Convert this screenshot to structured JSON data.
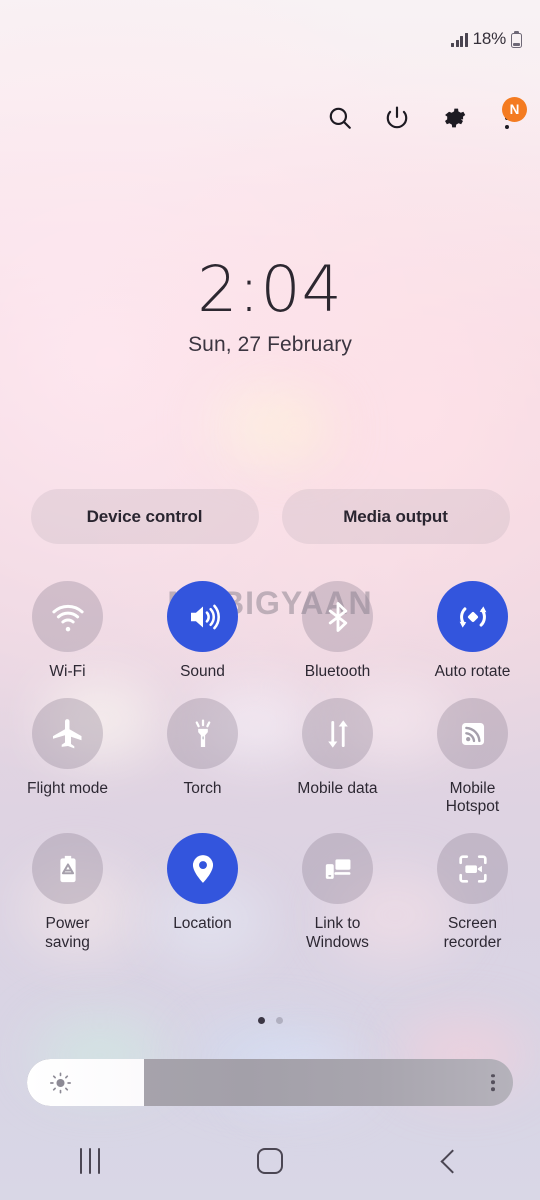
{
  "status_bar": {
    "battery_percent": "18%",
    "signal_icon": "signal-bars-icon",
    "battery_icon": "battery-low-icon"
  },
  "action_bar": {
    "search_icon": "search-icon",
    "power_icon": "power-icon",
    "settings_icon": "gear-icon",
    "more_icon": "kebab-menu-icon",
    "badge_label": "N",
    "badge_color": "#f47b20"
  },
  "clock": {
    "time": "2:04",
    "date": "Sun, 27 February"
  },
  "shortcuts": {
    "device_control": "Device control",
    "media_output": "Media output"
  },
  "toggles": [
    {
      "label": "Wi-Fi",
      "icon": "wifi-icon",
      "active": false
    },
    {
      "label": "Sound",
      "icon": "volume-speaker-icon",
      "active": true
    },
    {
      "label": "Bluetooth",
      "icon": "bluetooth-icon",
      "active": false
    },
    {
      "label": "Auto rotate",
      "icon": "auto-rotate-icon",
      "active": true
    },
    {
      "label": "Flight mode",
      "icon": "airplane-icon",
      "active": false
    },
    {
      "label": "Torch",
      "icon": "flashlight-icon",
      "active": false
    },
    {
      "label": "Mobile data",
      "icon": "data-arrows-icon",
      "active": false
    },
    {
      "label": "Mobile Hotspot",
      "icon": "hotspot-icon",
      "active": false
    },
    {
      "label": "Power saving",
      "icon": "battery-eco-icon",
      "active": false
    },
    {
      "label": "Location",
      "icon": "location-pin-icon",
      "active": true
    },
    {
      "label": "Link to Windows",
      "icon": "link-to-windows-icon",
      "active": false
    },
    {
      "label": "Screen recorder",
      "icon": "screen-recorder-icon",
      "active": false
    }
  ],
  "pager": {
    "total": 2,
    "active_index": 0
  },
  "brightness": {
    "level_percent": 24,
    "sun_icon": "brightness-sun-icon",
    "more_icon": "kebab-menu-icon"
  },
  "nav_bar": {
    "recents_icon": "recents-icon",
    "home_icon": "home-icon",
    "back_icon": "back-chevron-icon"
  },
  "watermark": {
    "text": "MOBIGYAAN"
  },
  "colors": {
    "accent_blue": "#3355dd",
    "inactive_tile": "rgba(139,128,146,0.33)",
    "badge_orange": "#f47b20",
    "text_primary": "#2d2833"
  }
}
